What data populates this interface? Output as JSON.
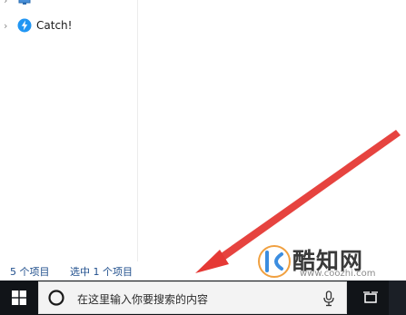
{
  "nav": {
    "items": [
      {
        "label": "",
        "icon": "monitor-icon"
      },
      {
        "label": "Catch!",
        "icon": "catch-lightning-icon"
      }
    ]
  },
  "status": {
    "item_count": "5 个项目",
    "selected": "选中 1 个项目"
  },
  "taskbar": {
    "search_placeholder": "在这里输入你要搜索的内容",
    "icons": [
      "windows-start-icon",
      "cortana-icon",
      "microphone-icon",
      "task-view-icon"
    ]
  },
  "watermark": {
    "brand": "酷知网",
    "url": "www.coozhi.com"
  },
  "colors": {
    "taskbar": "#111418",
    "search_box": "#f3f3f3",
    "status_text": "#1f4e8c",
    "arrow": "#e53935",
    "catch_icon": "#2196f3"
  }
}
